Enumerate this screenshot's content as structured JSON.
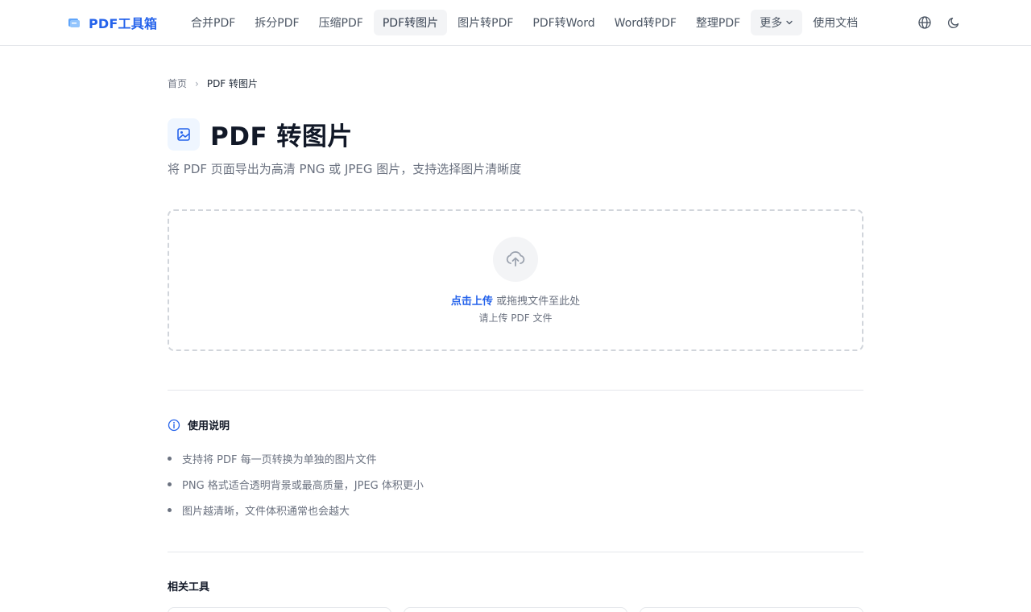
{
  "header": {
    "logo_text": "PDF工具箱",
    "nav": [
      {
        "label": "合并PDF"
      },
      {
        "label": "拆分PDF"
      },
      {
        "label": "压缩PDF"
      },
      {
        "label": "PDF转图片",
        "active": true
      },
      {
        "label": "图片转PDF"
      },
      {
        "label": "PDF转Word"
      },
      {
        "label": "Word转PDF"
      },
      {
        "label": "整理PDF"
      },
      {
        "label": "更多"
      },
      {
        "label": "使用文档"
      }
    ],
    "icons": [
      "globe-icon",
      "moon-icon"
    ]
  },
  "breadcrumb": {
    "home": "首页",
    "separator": "›",
    "current": "PDF 转图片"
  },
  "page": {
    "title": "PDF 转图片",
    "subtitle": "将 PDF 页面导出为高清 PNG 或 JPEG 图片，支持选择图片清晰度"
  },
  "upload": {
    "link_text": "点击上传",
    "main_text": " 或拖拽文件至此处",
    "hint": "请上传 PDF 文件"
  },
  "usage": {
    "title": "使用说明",
    "items": [
      "支持将 PDF 每一页转换为单独的图片文件",
      "PNG 格式适合透明背景或最高质量，JPEG 体积更小",
      "图片越清晰，文件体积通常也会越大"
    ]
  },
  "related": {
    "title": "相关工具"
  },
  "colors": {
    "accent": "#2563eb",
    "text_primary": "#111827",
    "text_muted": "#6b7280",
    "border": "#e5e7eb"
  }
}
